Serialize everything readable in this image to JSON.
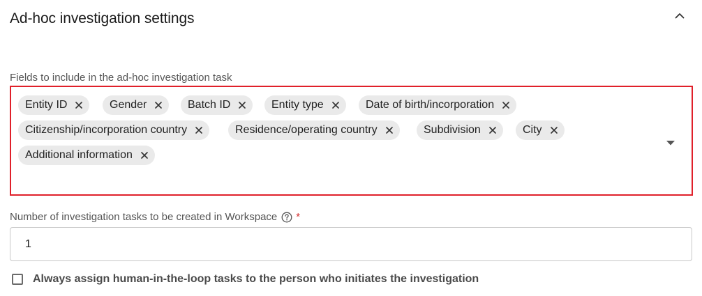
{
  "section": {
    "title": "Ad-hoc investigation settings"
  },
  "fields": {
    "label": "Fields to include in the ad-hoc investigation task",
    "chips": [
      {
        "label": "Entity ID"
      },
      {
        "label": "Gender"
      },
      {
        "label": "Batch ID"
      },
      {
        "label": "Entity type"
      },
      {
        "label": "Date of birth/incorporation"
      },
      {
        "label": "Citizenship/incorporation country"
      },
      {
        "label": "Residence/operating country"
      },
      {
        "label": "Subdivision"
      },
      {
        "label": "City"
      },
      {
        "label": "Additional information"
      }
    ]
  },
  "task_count": {
    "label": "Number of investigation tasks to be created in Workspace",
    "required_mark": "*",
    "value": "1"
  },
  "assign_option": {
    "label": "Always assign human-in-the-loop tasks to the person who initiates the investigation",
    "checked": false
  },
  "icons": {
    "collapse": "chevron-up-icon",
    "chip_remove": "close-icon",
    "dropdown": "caret-down-icon",
    "help": "help-circle-icon"
  },
  "colors": {
    "highlight_border": "#e0202a",
    "chip_background": "#eaeaea",
    "required": "#d32f2f"
  }
}
